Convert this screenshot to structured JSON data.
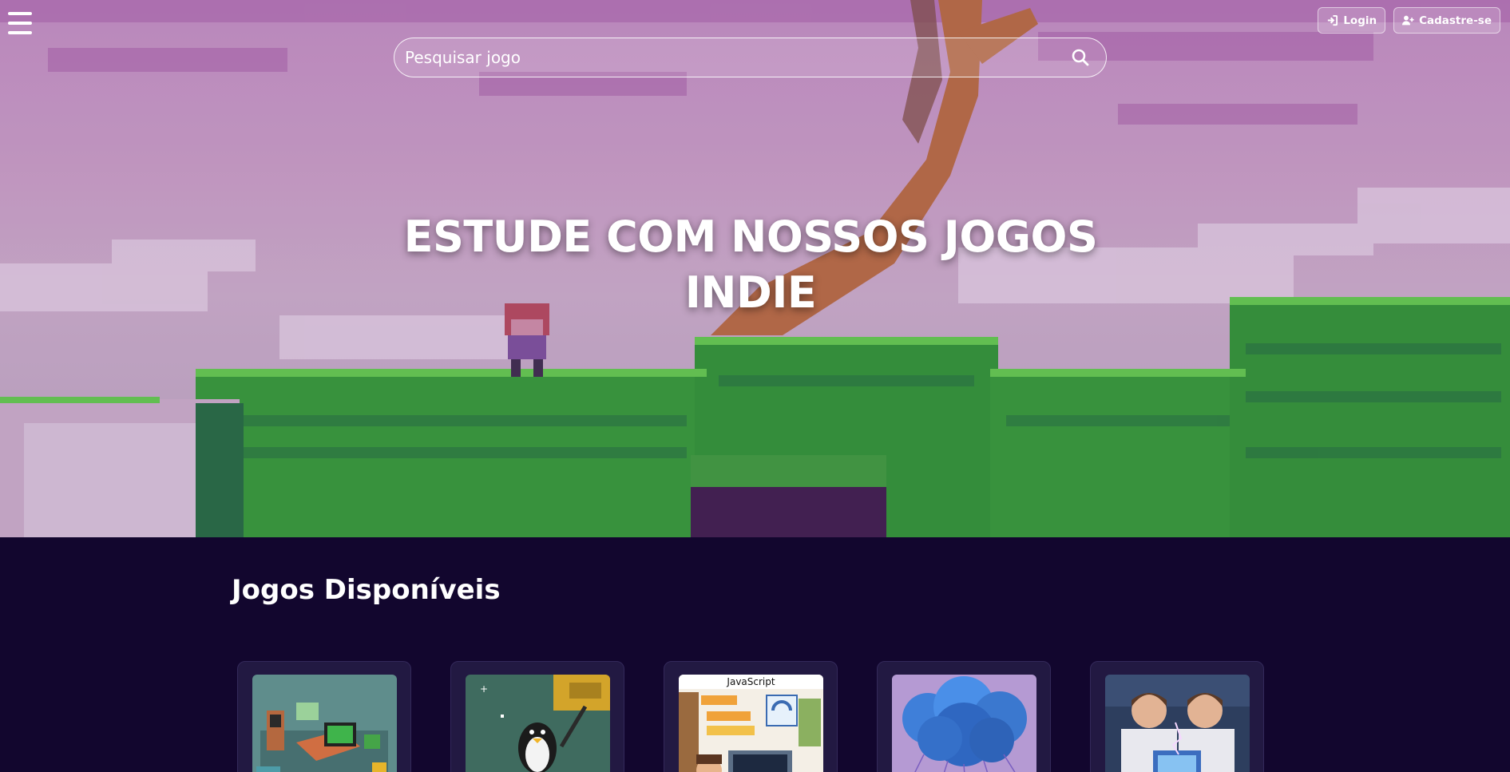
{
  "header": {
    "menu_icon": "hamburger-menu-icon",
    "search": {
      "placeholder": "Pesquisar jogo",
      "value": "",
      "icon": "search-icon"
    },
    "auth": {
      "login_label": "Login",
      "login_icon": "sign-in-icon",
      "signup_label": "Cadastre-se",
      "signup_icon": "user-plus-icon"
    }
  },
  "hero": {
    "title_line1": "ESTUDE COM NOSSOS JOGOS",
    "title_line2": "INDIE"
  },
  "games_section": {
    "title": "Jogos Disponíveis",
    "cards": [
      {
        "image": "pixel-computer-room-thumbnail"
      },
      {
        "image": "pixel-penguin-platformer-thumbnail"
      },
      {
        "image": "javascript-coding-thumbnail",
        "caption": "JavaScript"
      },
      {
        "image": "blue-cloud-network-thumbnail"
      },
      {
        "image": "scientists-circuit-board-thumbnail"
      }
    ]
  },
  "colors": {
    "page_background": "#12062e",
    "card_background": "#221942",
    "hero_sky": "#c28fc3",
    "grass": "#2f9d34"
  }
}
